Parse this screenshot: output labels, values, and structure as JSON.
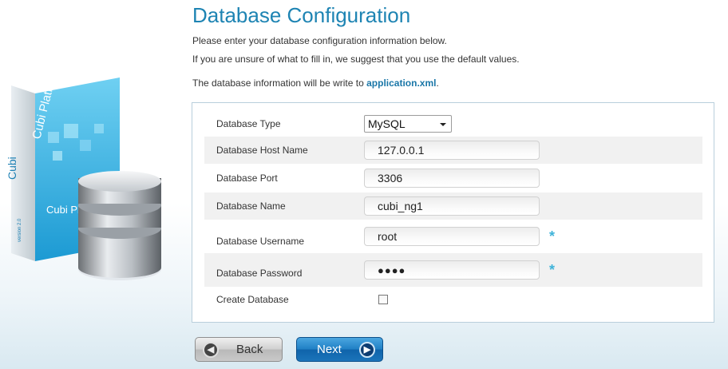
{
  "header": {
    "title": "Database Configuration",
    "intro_line1": "Please enter your database configuration information below.",
    "intro_line2": "If you are unsure of what to fill in, we suggest that you use the default values.",
    "intro_line3_prefix": "The database information will be write to ",
    "intro_line3_file": "application.xml",
    "intro_line3_suffix": "."
  },
  "hero": {
    "box_brand": "Cubi Platform",
    "box_brand_small": "Cubi Platf",
    "box_side": "Cubi",
    "box_version": "version 2.0"
  },
  "form": {
    "db_type": {
      "label": "Database Type",
      "value": "MySQL"
    },
    "host": {
      "label": "Database Host Name",
      "value": "127.0.0.1"
    },
    "port": {
      "label": "Database Port",
      "value": "3306"
    },
    "name": {
      "label": "Database Name",
      "value": "cubi_ng1"
    },
    "username": {
      "label": "Database Username",
      "value": "root",
      "required_mark": "*"
    },
    "password": {
      "label": "Database Password",
      "value": "●●●●",
      "required_mark": "*"
    },
    "create_db": {
      "label": "Create Database",
      "checked": false
    }
  },
  "buttons": {
    "back": "Back",
    "next": "Next"
  },
  "icons": {
    "back": "arrow-left-circle-icon",
    "next": "arrow-right-circle-icon",
    "dropdown": "chevron-down-icon"
  },
  "colors": {
    "title": "#1e84b3",
    "link": "#1b77a8",
    "required": "#3fb3d9",
    "next_button": "#1f7fc4"
  }
}
